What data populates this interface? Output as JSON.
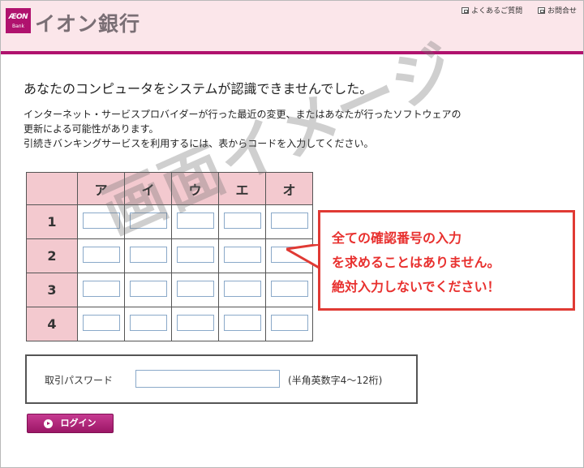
{
  "header": {
    "logo_mark_top": "ÆON",
    "logo_mark_bottom": "Bank",
    "logo_text": "イオン銀行",
    "links": [
      {
        "label": "よくあるご質問",
        "icon": "window-icon"
      },
      {
        "label": "お問合せ",
        "icon": "window-icon"
      }
    ],
    "accent_color": "#b0126e",
    "background_color": "#fbe6ea"
  },
  "main": {
    "heading": "あなたのコンピュータをシステムが認識できませんでした。",
    "message_lines": [
      "インターネット・サービスプロバイダーが行った最近の変更、またはあなたが行ったソフトウェアの",
      "更新による可能性があります。",
      "引続きバンキングサービスを利用するには、表からコードを入力してください。"
    ]
  },
  "grid": {
    "columns": [
      "ア",
      "イ",
      "ウ",
      "エ",
      "オ"
    ],
    "rows": [
      "1",
      "2",
      "3",
      "4"
    ],
    "header_color": "#f3c9cf"
  },
  "watermark": "画面イメージ",
  "callout": {
    "lines": [
      "全ての確認番号の入力",
      "を求めることはありません。",
      "絶対入力しないでください！"
    ],
    "color": "#e8302e"
  },
  "password": {
    "label": "取引パスワード",
    "value": "",
    "hint": "(半角英数字4〜12桁)"
  },
  "login_button": {
    "label": "ログイン",
    "icon": "play-circle-icon"
  }
}
